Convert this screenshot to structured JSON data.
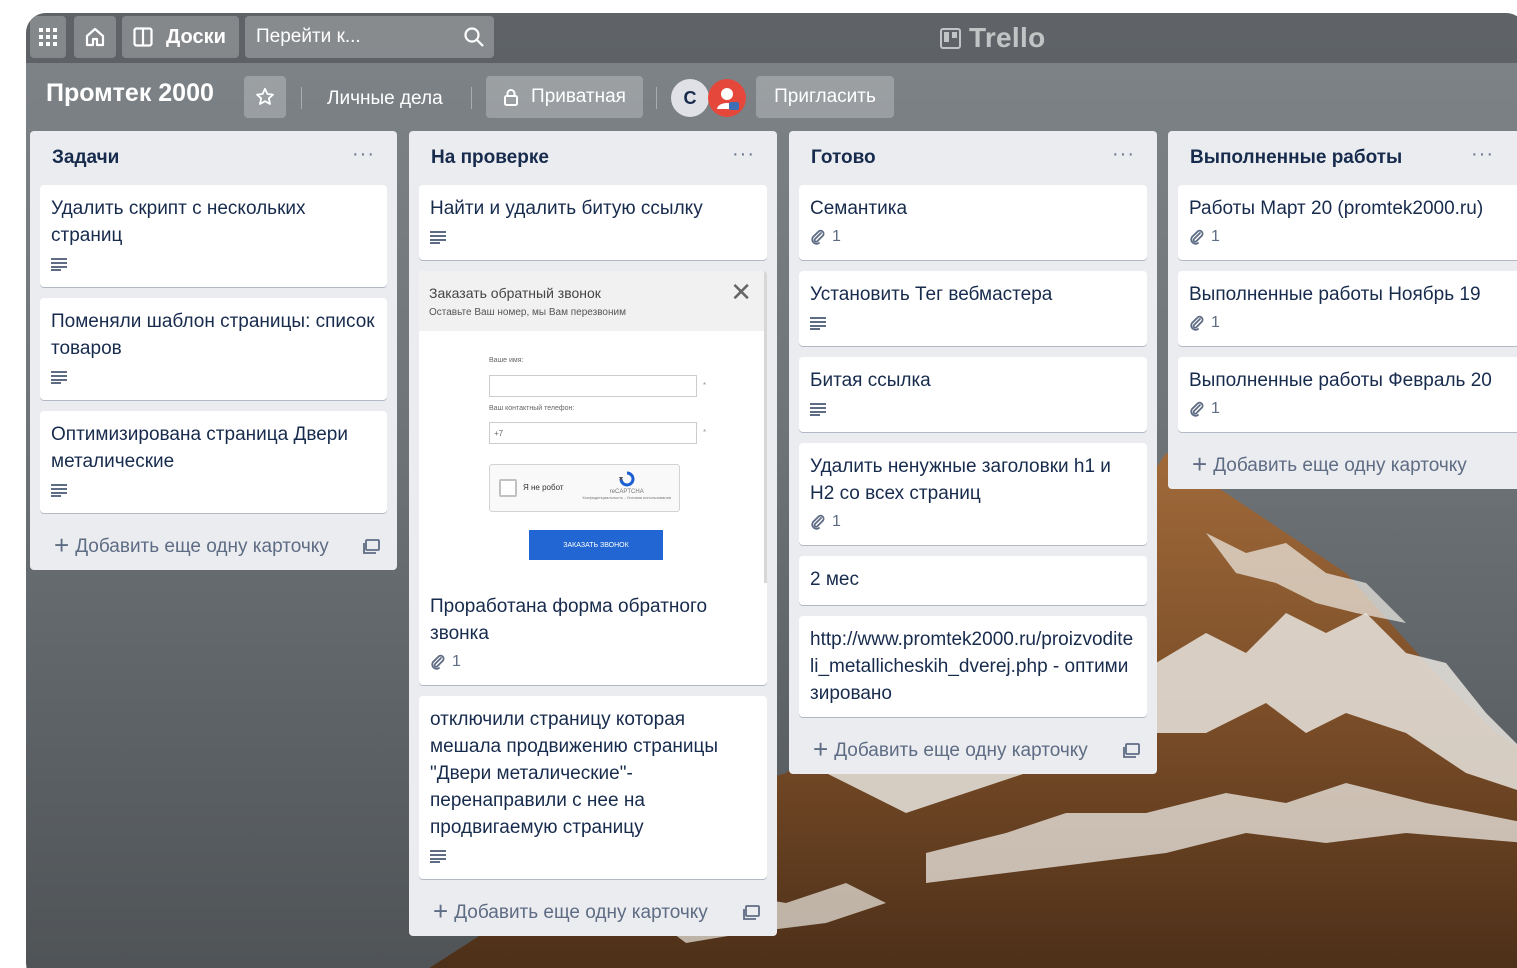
{
  "app": {
    "logo_text": "Trello"
  },
  "topbar": {
    "boards_label": "Доски",
    "search_label": "Перейти к..."
  },
  "board": {
    "title": "Промтек 2000",
    "team_label": "Личные дела",
    "visibility_label": "Приватная",
    "member_initial": "С",
    "invite_label": "Пригласить"
  },
  "lists": [
    {
      "title": "Задачи",
      "menu": "···",
      "add_label": "Добавить еще одну карточку",
      "cards": [
        {
          "title": "Удалить скрипт с нескольких страниц"
        },
        {
          "title": "Поменяли шаблон страницы: список товаров"
        },
        {
          "title": "Оптимизирована страница Двери металические"
        }
      ]
    },
    {
      "title": "На проверке",
      "menu": "···",
      "add_label": "Добавить еще одну карточку",
      "cards": [
        {
          "title": "Найти и удалить битую ссылку"
        },
        {
          "title": "Проработана форма обратного звонка",
          "attachments": "1",
          "cover": {
            "title": "Заказать обратный звонок",
            "subtitle": "Оставьте Ваш номер, мы Вам перезвоним",
            "close": "✕",
            "name_label": "Ваше имя:",
            "phone_label": "Ваш контактный телефон:",
            "phone_value": "+7",
            "required_mark": "*",
            "captcha_label": "Я не робот",
            "captcha_brand": "reCAPTCHA",
            "captcha_terms": "Конфиденциальность - Условия использования",
            "submit_label": "ЗАКАЗАТЬ ЗВОНОК"
          }
        },
        {
          "title": "отключили страницу которая мешала продвижению страницы \"Двери металические\"- перенаправили с нее на продвигаемую страницу"
        }
      ]
    },
    {
      "title": "Готово",
      "menu": "···",
      "add_label": "Добавить еще одну карточку",
      "cards": [
        {
          "title": "Семантика",
          "attachments": "1"
        },
        {
          "title": "Установить Тег вебмастера"
        },
        {
          "title": "Битая ссылка"
        },
        {
          "title": "Удалить ненужные заголовки h1 и Н2 со всех страниц",
          "attachments": "1"
        },
        {
          "title": "2 мес"
        },
        {
          "title": "http://www.promtek2000.ru/proizvoditeli_metallicheskih_dverej.php - оптимизировано"
        }
      ]
    },
    {
      "title": "Выполненные работы",
      "menu": "···",
      "add_label": "Добавить еще одну карточку",
      "cards": [
        {
          "title": "Работы Март 20 (promtek2000.ru)",
          "attachments": "1"
        },
        {
          "title": "Выполненные работы Ноябрь 19",
          "attachments": "1"
        },
        {
          "title": "Выполненные работы Февраль 20",
          "attachments": "1"
        }
      ]
    }
  ],
  "colors": {
    "list_bg": "#ebecf0",
    "card_bg": "#ffffff",
    "text": "#172b4d",
    "muted": "#5e6c84",
    "avatar_red": "#e5483b",
    "button_blue": "#2266d3"
  }
}
